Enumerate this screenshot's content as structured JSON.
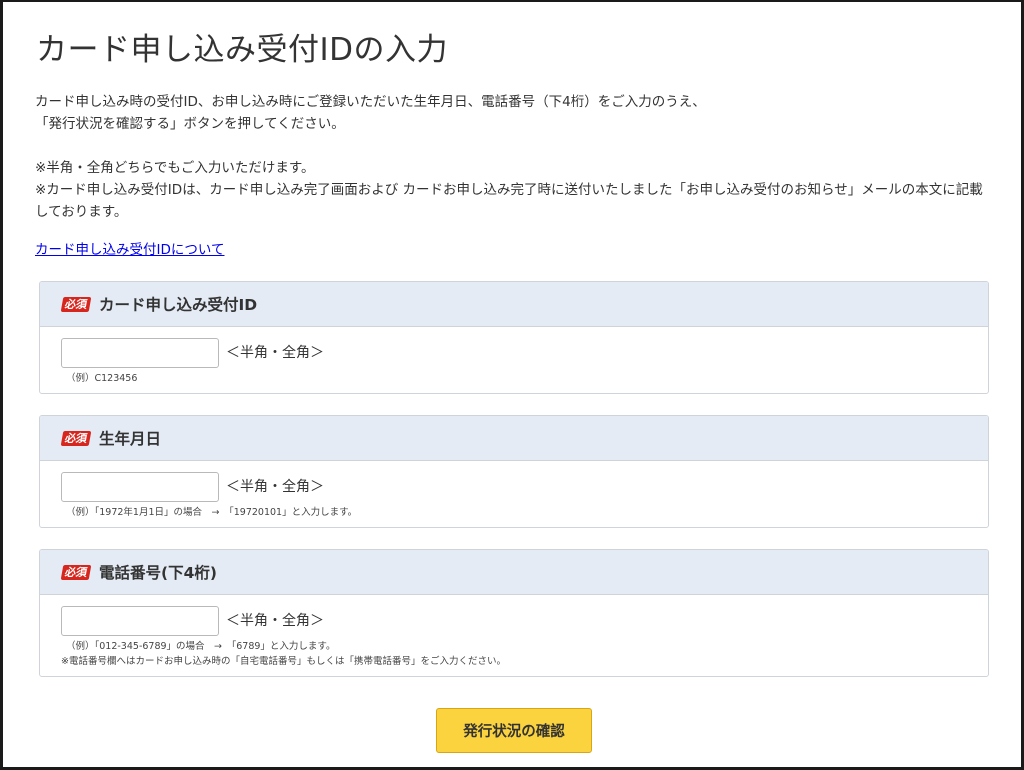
{
  "page": {
    "title": "カード申し込み受付IDの入力"
  },
  "intro": {
    "line1": "カード申し込み時の受付ID、お申し込み時にご登録いただいた生年月日、電話番号（下4桁）をご入力のうえ、",
    "line2": "「発行状況を確認する」ボタンを押してください。",
    "note1": "※半角・全角どちらでもご入力いただけます。",
    "note2": "※カード申し込み受付IDは、カード申し込み完了画面および カードお申し込み完了時に送付いたしました「お申し込み受付のお知らせ」メールの本文に記載しております。"
  },
  "link": {
    "label": "カード申し込み受付IDについて"
  },
  "required_badge": "必須",
  "input_hint": "＜半角・全角＞",
  "fields": [
    {
      "label": "カード申し込み受付ID",
      "value": "",
      "example": "（例）C123456",
      "note": ""
    },
    {
      "label": "生年月日",
      "value": "",
      "example": "（例）「1972年1月1日」の場合　→　「19720101」と入力します。",
      "note": ""
    },
    {
      "label": "電話番号(下4桁)",
      "value": "",
      "example": "（例）「012-345-6789」の場合　→　「6789」と入力します。",
      "note": "※電話番号欄へはカードお申し込み時の「自宅電話番号」もしくは「携帯電話番号」をご入力ください。"
    }
  ],
  "submit": {
    "label": "発行状況の確認"
  },
  "colors": {
    "panel_header_bg": "#e4ebf5",
    "required_badge": "#d7261d",
    "button_bg": "#fbd33e",
    "link": "#0000ee"
  }
}
